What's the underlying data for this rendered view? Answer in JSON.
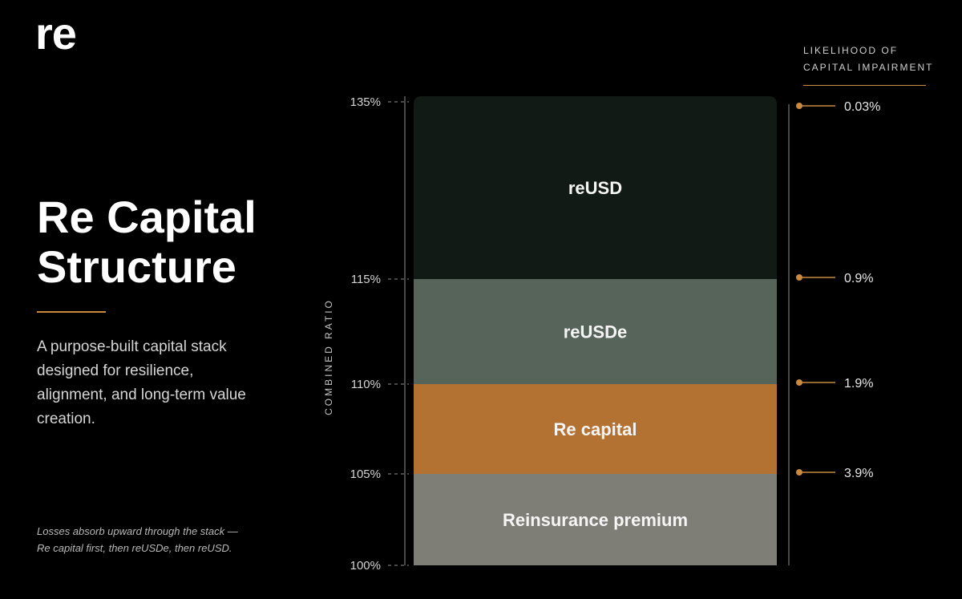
{
  "brand": {
    "logo": "re"
  },
  "colors": {
    "accent": "#c98a3d",
    "bands": {
      "reUSD": "#121a15",
      "reUSDe": "#56645a",
      "Re capital": "#b47232",
      "Reinsurance premium": "#7f7e76"
    }
  },
  "left": {
    "title_line1": "Re Capital",
    "title_line2": "Structure",
    "description": "A purpose-built capital stack designed for resilience, alignment, and long-term value creation.",
    "footnote_line1": "Losses absorb upward through the stack —",
    "footnote_line2": "Re capital first, then reUSDe, then reUSD."
  },
  "right_axis": {
    "heading_line1": "LIKELIHOOD OF",
    "heading_line2": "CAPITAL IMPAIRMENT"
  },
  "chart_data": {
    "type": "bar",
    "stacked": true,
    "ylabel": "COMBINED RATIO",
    "ylim": [
      100,
      135
    ],
    "y_ticks": [
      100,
      105,
      110,
      115,
      135
    ],
    "y_tick_labels": [
      "100%",
      "105%",
      "110%",
      "115%",
      "135%"
    ],
    "segments": [
      {
        "label": "Reinsurance premium",
        "from": 100,
        "to": 105
      },
      {
        "label": "Re capital",
        "from": 105,
        "to": 110
      },
      {
        "label": "reUSDe",
        "from": 110,
        "to": 115
      },
      {
        "label": "reUSD",
        "from": 115,
        "to": 135
      }
    ],
    "impairment": [
      {
        "at": 135,
        "label": "0.03%"
      },
      {
        "at": 115,
        "label": "0.9%"
      },
      {
        "at": 110,
        "label": "1.9%"
      },
      {
        "at": 105,
        "label": "3.9%"
      }
    ]
  }
}
